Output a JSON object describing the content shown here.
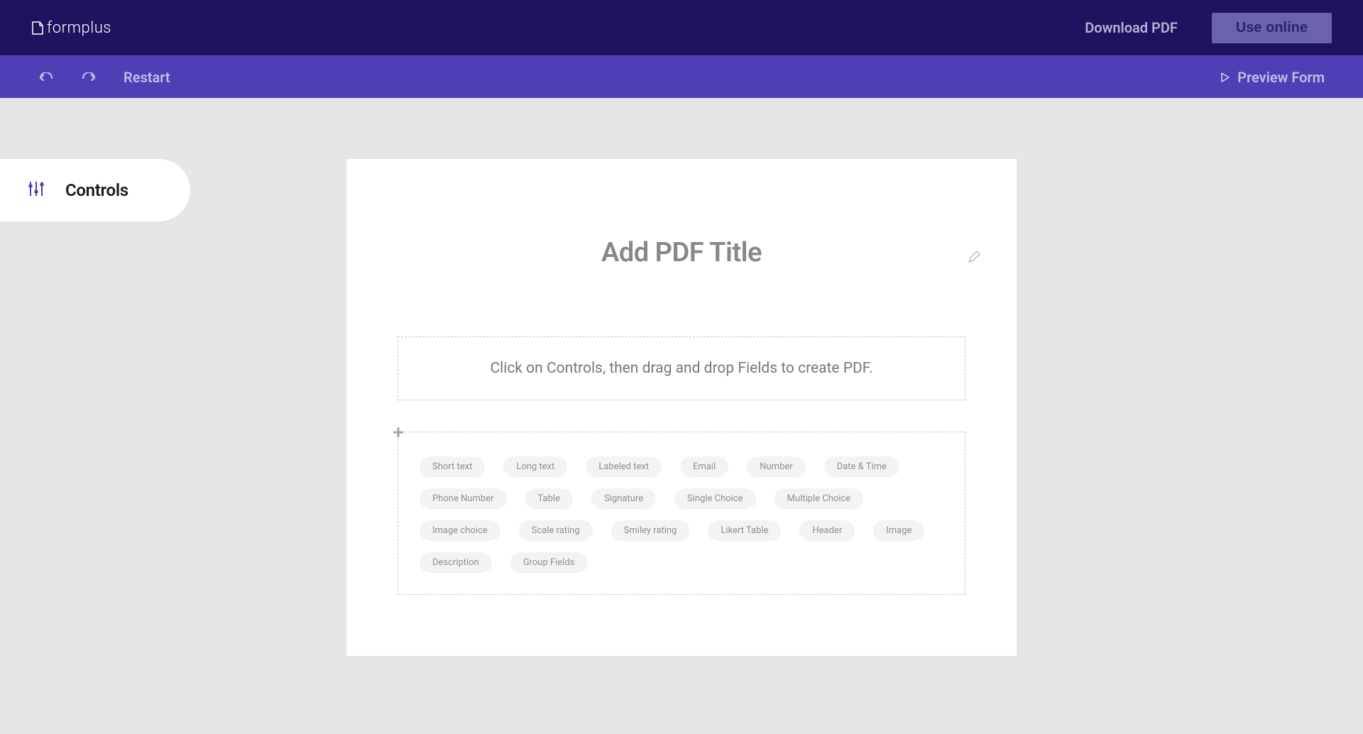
{
  "header": {
    "brand": "formplus",
    "download_label": "Download PDF",
    "use_online_label": "Use online"
  },
  "toolbar": {
    "restart_label": "Restart",
    "preview_label": "Preview Form"
  },
  "sidebar": {
    "controls_label": "Controls"
  },
  "canvas": {
    "title_placeholder": "Add PDF Title",
    "hint": "Click on Controls, then drag and drop Fields to create PDF."
  },
  "fields": [
    "Short text",
    "Long text",
    "Labeled text",
    "Email",
    "Number",
    "Date & Time",
    "Phone Number",
    "Table",
    "Signature",
    "Single Choice",
    "Multiple Choice",
    "Image choice",
    "Scale rating",
    "Smiley rating",
    "Likert Table",
    "Header",
    "Image",
    "Description",
    "Group Fields"
  ]
}
